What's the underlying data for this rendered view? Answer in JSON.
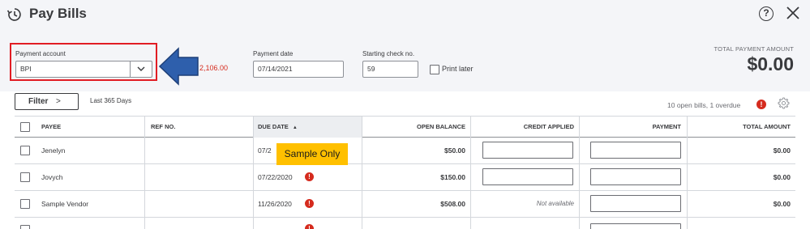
{
  "window": {
    "title": "Pay Bills",
    "help_glyph": "?"
  },
  "header": {
    "payment_account": {
      "label": "Payment account",
      "value": "BPI"
    },
    "balance": "2,106.00",
    "payment_date": {
      "label": "Payment date",
      "value": "07/14/2021"
    },
    "starting_check": {
      "label": "Starting check no.",
      "value": "59"
    },
    "print_later": {
      "label": "Print later",
      "checked": false
    },
    "total": {
      "label": "TOTAL PAYMENT AMOUNT",
      "value": "$0.00"
    }
  },
  "toolbar": {
    "filter_label": "Filter",
    "filter_chevron": ">",
    "range": "Last 365 Days",
    "open_bills": "10 open bills, 1 overdue",
    "overdue_glyph": "!"
  },
  "table": {
    "columns": {
      "payee": "PAYEE",
      "ref": "REF NO.",
      "due": "DUE DATE",
      "due_sort": "▲",
      "open_balance": "OPEN BALANCE",
      "credit": "CREDIT APPLIED",
      "payment": "PAYMENT",
      "total": "TOTAL AMOUNT"
    },
    "rows": [
      {
        "payee": "Jenelyn",
        "due": "07/2",
        "open_balance": "$50.00",
        "credit": "",
        "payment": "",
        "total": "$0.00"
      },
      {
        "payee": "Jovych",
        "due": "07/22/2020",
        "open_balance": "$150.00",
        "credit": "",
        "payment": "",
        "total": "$0.00"
      },
      {
        "payee": "Sample Vendor",
        "due": "11/26/2020",
        "open_balance": "$508.00",
        "credit": "Not available",
        "payment": "",
        "total": "$0.00"
      }
    ],
    "warn_glyph": "!"
  },
  "overlay": {
    "sample_label": "Sample Only"
  },
  "colors": {
    "highlight_border": "#e11d24",
    "arrow_fill": "#2e5fac",
    "overdue_red": "#d52b1e",
    "sample_badge": "#ffc000"
  },
  "icons": {
    "title": "clock-refresh-icon",
    "help": "help-icon",
    "close": "close-icon",
    "settings": "gear-icon",
    "select": "chevron-down-icon"
  }
}
